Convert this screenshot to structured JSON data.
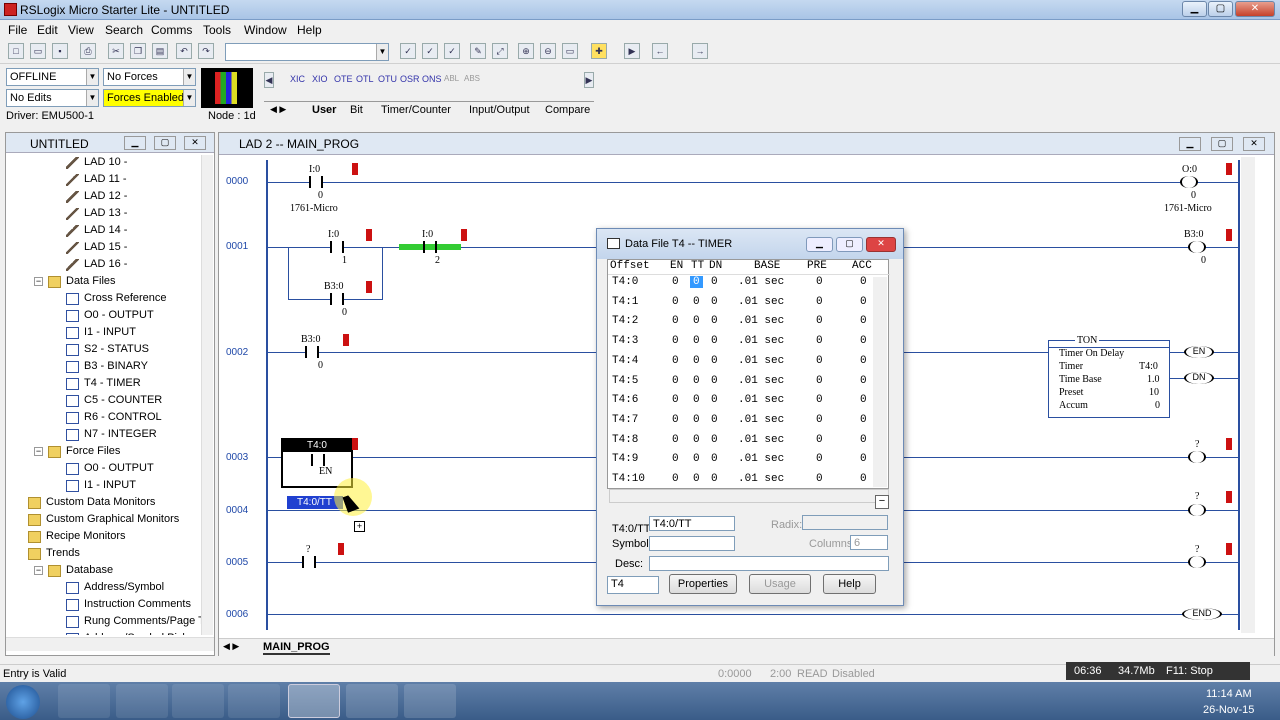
{
  "app": {
    "title": "RSLogix Micro Starter Lite - UNTITLED"
  },
  "menu": [
    "File",
    "Edit",
    "View",
    "Search",
    "Comms",
    "Tools",
    "Window",
    "Help"
  ],
  "status_panel": {
    "mode": "OFFLINE",
    "forces": "No Forces",
    "edits": "No Edits",
    "forces_enabled": "Forces Enabled",
    "driver": "Driver: EMU500-1",
    "node": "Node :  1d"
  },
  "instr_tabs": [
    "User",
    "Bit",
    "Timer/Counter",
    "Input/Output",
    "Compare"
  ],
  "instr_icons": [
    "XIC",
    "XIO",
    "OTE",
    "OTL",
    "OTU",
    "OSR",
    "ONS",
    "ABL",
    "ABS"
  ],
  "project": {
    "title": "UNTITLED",
    "items": [
      {
        "label": "LAD 10 -"
      },
      {
        "label": "LAD 11 -"
      },
      {
        "label": "LAD 12 -"
      },
      {
        "label": "LAD 13 -"
      },
      {
        "label": "LAD 14 -"
      },
      {
        "label": "LAD 15 -"
      },
      {
        "label": "LAD 16 -"
      },
      {
        "label": "Data Files"
      },
      {
        "label": "Cross Reference"
      },
      {
        "label": "O0 - OUTPUT"
      },
      {
        "label": "I1 - INPUT"
      },
      {
        "label": "S2 - STATUS"
      },
      {
        "label": "B3 - BINARY"
      },
      {
        "label": "T4 - TIMER"
      },
      {
        "label": "C5 - COUNTER"
      },
      {
        "label": "R6 - CONTROL"
      },
      {
        "label": "N7 - INTEGER"
      },
      {
        "label": "Force Files"
      },
      {
        "label": "O0 - OUTPUT"
      },
      {
        "label": "I1 - INPUT"
      },
      {
        "label": "Custom Data Monitors"
      },
      {
        "label": "Custom Graphical Monitors"
      },
      {
        "label": "Recipe Monitors"
      },
      {
        "label": "Trends"
      },
      {
        "label": "Database"
      },
      {
        "label": "Address/Symbol"
      },
      {
        "label": "Instruction Comments"
      },
      {
        "label": "Rung Comments/Page Ti"
      },
      {
        "label": "Address/Symbol Picker"
      }
    ]
  },
  "ladder": {
    "title": "LAD 2 -- MAIN_PROG",
    "tab": "MAIN_PROG",
    "rungs": [
      "0000",
      "0001",
      "0002",
      "0003",
      "0004",
      "0005",
      "0006"
    ],
    "labels": {
      "r0_in_addr": "I:0",
      "r0_in_bit": "0",
      "r0_in_sym": "1761-Micro",
      "r0_out_addr": "O:0",
      "r0_out_bit": "0",
      "r0_out_sym": "1761-Micro",
      "r1_a_addr": "I:0",
      "r1_a_bit": "1",
      "r1_b_addr": "I:0",
      "r1_b_bit": "2",
      "r1_c_addr": "B3:0",
      "r1_c_bit": "0",
      "r1_out_addr": "B3:0",
      "r1_out_bit": "0",
      "r2_in_addr": "B3:0",
      "r2_in_bit": "0",
      "ton_title": "TON",
      "ton_name": "Timer On Delay",
      "ton_timer_k": "Timer",
      "ton_timer_v": "T4:0",
      "ton_base_k": "Time Base",
      "ton_base_v": "1.0",
      "ton_preset_k": "Preset",
      "ton_preset_v": "10",
      "ton_accum_k": "Accum",
      "ton_accum_v": "0",
      "en": "EN",
      "dn": "DN",
      "r3_drag_addr": "T4:0",
      "r3_drag_bit": "EN",
      "r4_drag": "T4:0/TT",
      "q": "?",
      "end": "END"
    }
  },
  "datafile": {
    "title": "Data File T4  --  TIMER",
    "headers": [
      "Offset",
      "EN",
      "TT",
      "DN",
      "BASE",
      "PRE",
      "ACC"
    ],
    "rows": [
      [
        "T4:0",
        "0",
        "0",
        "0",
        ".01 sec",
        "0",
        "0"
      ],
      [
        "T4:1",
        "0",
        "0",
        "0",
        ".01 sec",
        "0",
        "0"
      ],
      [
        "T4:2",
        "0",
        "0",
        "0",
        ".01 sec",
        "0",
        "0"
      ],
      [
        "T4:3",
        "0",
        "0",
        "0",
        ".01 sec",
        "0",
        "0"
      ],
      [
        "T4:4",
        "0",
        "0",
        "0",
        ".01 sec",
        "0",
        "0"
      ],
      [
        "T4:5",
        "0",
        "0",
        "0",
        ".01 sec",
        "0",
        "0"
      ],
      [
        "T4:6",
        "0",
        "0",
        "0",
        ".01 sec",
        "0",
        "0"
      ],
      [
        "T4:7",
        "0",
        "0",
        "0",
        ".01 sec",
        "0",
        "0"
      ],
      [
        "T4:8",
        "0",
        "0",
        "0",
        ".01 sec",
        "0",
        "0"
      ],
      [
        "T4:9",
        "0",
        "0",
        "0",
        ".01 sec",
        "0",
        "0"
      ],
      [
        "T4:10",
        "0",
        "0",
        "0",
        ".01 sec",
        "0",
        "0"
      ]
    ],
    "address": "T4:0/TT",
    "radix_label": "Radix:",
    "symbol_label": "Symbol:",
    "columns_label": "Columns:",
    "columns_value": "6",
    "desc_label": "Desc:",
    "file": "T4",
    "buttons": {
      "properties": "Properties",
      "usage": "Usage",
      "help": "Help"
    }
  },
  "status": {
    "message": "Entry is Valid",
    "addr": "0:0000",
    "pos": "2:00",
    "mode": "READ",
    "state": "Disabled"
  },
  "taskbar": {
    "time_elapsed": "06:36",
    "mem": "34.7Mb",
    "hint": "F11: Stop",
    "clock": "11:14 AM",
    "date": "26-Nov-15"
  }
}
